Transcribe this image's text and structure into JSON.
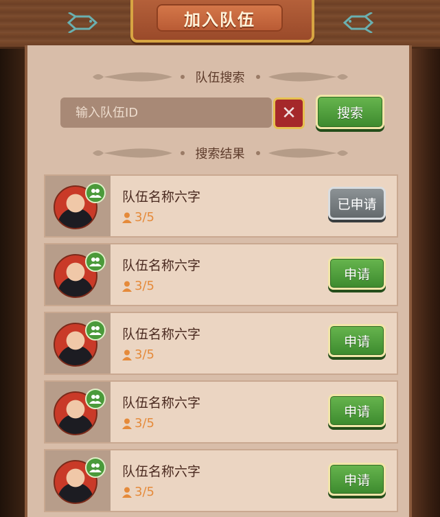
{
  "header": {
    "title": "加入队伍"
  },
  "search_section": {
    "label": "队伍搜索",
    "input_placeholder": "输入队伍ID",
    "input_value": "",
    "search_button": "搜索"
  },
  "results_section": {
    "label": "搜索结果"
  },
  "teams": [
    {
      "name": "队伍名称六字",
      "count": "3/5",
      "button": "已申请",
      "applied": true
    },
    {
      "name": "队伍名称六字",
      "count": "3/5",
      "button": "申请",
      "applied": false
    },
    {
      "name": "队伍名称六字",
      "count": "3/5",
      "button": "申请",
      "applied": false
    },
    {
      "name": "队伍名称六字",
      "count": "3/5",
      "button": "申请",
      "applied": false
    },
    {
      "name": "队伍名称六字",
      "count": "3/5",
      "button": "申请",
      "applied": false
    }
  ],
  "colors": {
    "panel": "#d8bda9",
    "apply_green": "#4e9c3c",
    "applied_gray": "#7a8083",
    "count_orange": "#e58a3a"
  }
}
